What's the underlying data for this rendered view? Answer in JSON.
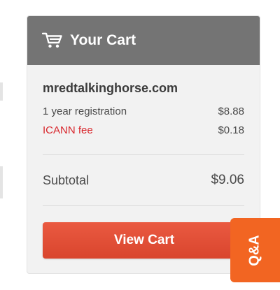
{
  "cart": {
    "title": "Your Cart",
    "icon": "shopping-cart-icon",
    "item": {
      "domain": "mredtalkinghorse.com",
      "registration_label": "1 year registration",
      "registration_price": "$8.88",
      "fee_label": "ICANN fee",
      "fee_price": "$0.18"
    },
    "subtotal_label": "Subtotal",
    "subtotal_amount": "$9.06",
    "view_cart_label": "View Cart"
  },
  "qa_tab": {
    "label": "Q&A"
  },
  "colors": {
    "header": "#747474",
    "button": "#e0492f",
    "qa_tab": "#f26522",
    "fee_text": "#d8262c"
  }
}
